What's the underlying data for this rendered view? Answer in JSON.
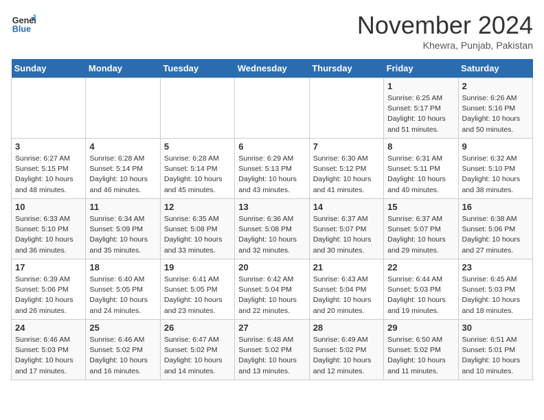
{
  "header": {
    "logo_line1": "General",
    "logo_line2": "Blue",
    "month": "November 2024",
    "location": "Khewra, Punjab, Pakistan"
  },
  "weekdays": [
    "Sunday",
    "Monday",
    "Tuesday",
    "Wednesday",
    "Thursday",
    "Friday",
    "Saturday"
  ],
  "weeks": [
    [
      {
        "day": "",
        "info": ""
      },
      {
        "day": "",
        "info": ""
      },
      {
        "day": "",
        "info": ""
      },
      {
        "day": "",
        "info": ""
      },
      {
        "day": "",
        "info": ""
      },
      {
        "day": "1",
        "info": "Sunrise: 6:25 AM\nSunset: 5:17 PM\nDaylight: 10 hours\nand 51 minutes."
      },
      {
        "day": "2",
        "info": "Sunrise: 6:26 AM\nSunset: 5:16 PM\nDaylight: 10 hours\nand 50 minutes."
      }
    ],
    [
      {
        "day": "3",
        "info": "Sunrise: 6:27 AM\nSunset: 5:15 PM\nDaylight: 10 hours\nand 48 minutes."
      },
      {
        "day": "4",
        "info": "Sunrise: 6:28 AM\nSunset: 5:14 PM\nDaylight: 10 hours\nand 46 minutes."
      },
      {
        "day": "5",
        "info": "Sunrise: 6:28 AM\nSunset: 5:14 PM\nDaylight: 10 hours\nand 45 minutes."
      },
      {
        "day": "6",
        "info": "Sunrise: 6:29 AM\nSunset: 5:13 PM\nDaylight: 10 hours\nand 43 minutes."
      },
      {
        "day": "7",
        "info": "Sunrise: 6:30 AM\nSunset: 5:12 PM\nDaylight: 10 hours\nand 41 minutes."
      },
      {
        "day": "8",
        "info": "Sunrise: 6:31 AM\nSunset: 5:11 PM\nDaylight: 10 hours\nand 40 minutes."
      },
      {
        "day": "9",
        "info": "Sunrise: 6:32 AM\nSunset: 5:10 PM\nDaylight: 10 hours\nand 38 minutes."
      }
    ],
    [
      {
        "day": "10",
        "info": "Sunrise: 6:33 AM\nSunset: 5:10 PM\nDaylight: 10 hours\nand 36 minutes."
      },
      {
        "day": "11",
        "info": "Sunrise: 6:34 AM\nSunset: 5:09 PM\nDaylight: 10 hours\nand 35 minutes."
      },
      {
        "day": "12",
        "info": "Sunrise: 6:35 AM\nSunset: 5:08 PM\nDaylight: 10 hours\nand 33 minutes."
      },
      {
        "day": "13",
        "info": "Sunrise: 6:36 AM\nSunset: 5:08 PM\nDaylight: 10 hours\nand 32 minutes."
      },
      {
        "day": "14",
        "info": "Sunrise: 6:37 AM\nSunset: 5:07 PM\nDaylight: 10 hours\nand 30 minutes."
      },
      {
        "day": "15",
        "info": "Sunrise: 6:37 AM\nSunset: 5:07 PM\nDaylight: 10 hours\nand 29 minutes."
      },
      {
        "day": "16",
        "info": "Sunrise: 6:38 AM\nSunset: 5:06 PM\nDaylight: 10 hours\nand 27 minutes."
      }
    ],
    [
      {
        "day": "17",
        "info": "Sunrise: 6:39 AM\nSunset: 5:06 PM\nDaylight: 10 hours\nand 26 minutes."
      },
      {
        "day": "18",
        "info": "Sunrise: 6:40 AM\nSunset: 5:05 PM\nDaylight: 10 hours\nand 24 minutes."
      },
      {
        "day": "19",
        "info": "Sunrise: 6:41 AM\nSunset: 5:05 PM\nDaylight: 10 hours\nand 23 minutes."
      },
      {
        "day": "20",
        "info": "Sunrise: 6:42 AM\nSunset: 5:04 PM\nDaylight: 10 hours\nand 22 minutes."
      },
      {
        "day": "21",
        "info": "Sunrise: 6:43 AM\nSunset: 5:04 PM\nDaylight: 10 hours\nand 20 minutes."
      },
      {
        "day": "22",
        "info": "Sunrise: 6:44 AM\nSunset: 5:03 PM\nDaylight: 10 hours\nand 19 minutes."
      },
      {
        "day": "23",
        "info": "Sunrise: 6:45 AM\nSunset: 5:03 PM\nDaylight: 10 hours\nand 18 minutes."
      }
    ],
    [
      {
        "day": "24",
        "info": "Sunrise: 6:46 AM\nSunset: 5:03 PM\nDaylight: 10 hours\nand 17 minutes."
      },
      {
        "day": "25",
        "info": "Sunrise: 6:46 AM\nSunset: 5:02 PM\nDaylight: 10 hours\nand 16 minutes."
      },
      {
        "day": "26",
        "info": "Sunrise: 6:47 AM\nSunset: 5:02 PM\nDaylight: 10 hours\nand 14 minutes."
      },
      {
        "day": "27",
        "info": "Sunrise: 6:48 AM\nSunset: 5:02 PM\nDaylight: 10 hours\nand 13 minutes."
      },
      {
        "day": "28",
        "info": "Sunrise: 6:49 AM\nSunset: 5:02 PM\nDaylight: 10 hours\nand 12 minutes."
      },
      {
        "day": "29",
        "info": "Sunrise: 6:50 AM\nSunset: 5:02 PM\nDaylight: 10 hours\nand 11 minutes."
      },
      {
        "day": "30",
        "info": "Sunrise: 6:51 AM\nSunset: 5:01 PM\nDaylight: 10 hours\nand 10 minutes."
      }
    ]
  ]
}
